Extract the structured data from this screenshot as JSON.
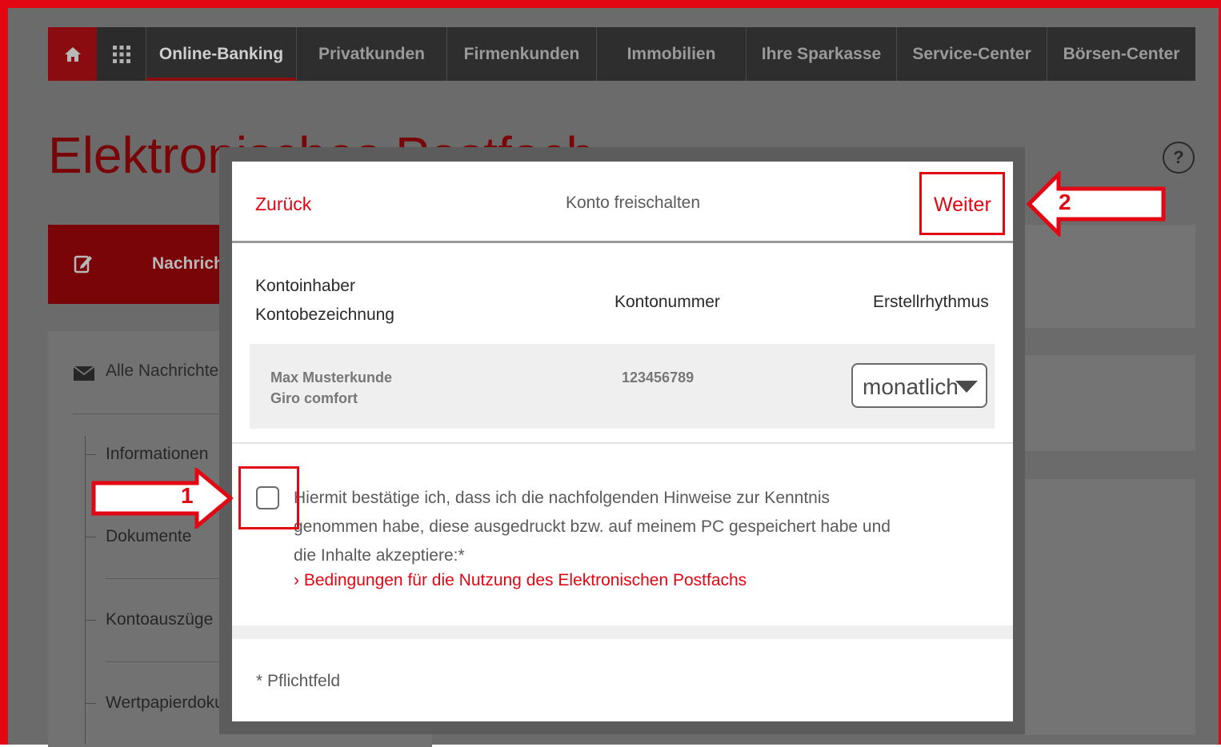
{
  "nav": {
    "home_icon": "home-icon",
    "apps_icon": "grid-icon",
    "items": [
      {
        "label": "Online-Banking",
        "active": true
      },
      {
        "label": "Privatkunden",
        "active": false
      },
      {
        "label": "Firmenkunden",
        "active": false
      },
      {
        "label": "Immobilien",
        "active": false
      },
      {
        "label": "Ihre Sparkasse",
        "active": false
      },
      {
        "label": "Service-Center",
        "active": false
      },
      {
        "label": "Börsen-Center",
        "active": false
      }
    ]
  },
  "page": {
    "title": "Elektronisches Postfach",
    "help": "?",
    "compose_label": "Nachricht",
    "sidebar_main": "Alle Nachrichten",
    "sidebar_items": [
      "Informationen",
      "Dokumente",
      "Kontoauszüge",
      "Wertpapierdokun"
    ]
  },
  "modal": {
    "back_label": "Zurück",
    "title": "Konto freischalten",
    "next_label": "Weiter",
    "columns": {
      "holder": "Kontoinhaber",
      "description": "Kontobezeichnung",
      "number": "Kontonummer",
      "rhythm": "Erstellrhythmus"
    },
    "account": {
      "holder": "Max Musterkunde",
      "description": "Giro comfort",
      "number": "123456789",
      "rhythm": "monatlich"
    },
    "confirm_lines": [
      "Hiermit bestätige ich, dass ich die nachfolgenden Hinweise zur Kenntnis",
      "genommen habe, diese ausgedruckt bzw. auf meinem PC gespeichert habe und",
      "die Inhalte akzeptiere:*"
    ],
    "terms_link": "› Bedingungen für die Nutzung des Elektronischen Postfachs",
    "required_note": "* Pflichtfeld"
  },
  "annotations": {
    "step1": "1",
    "step2": "2",
    "color": "#e30613"
  }
}
